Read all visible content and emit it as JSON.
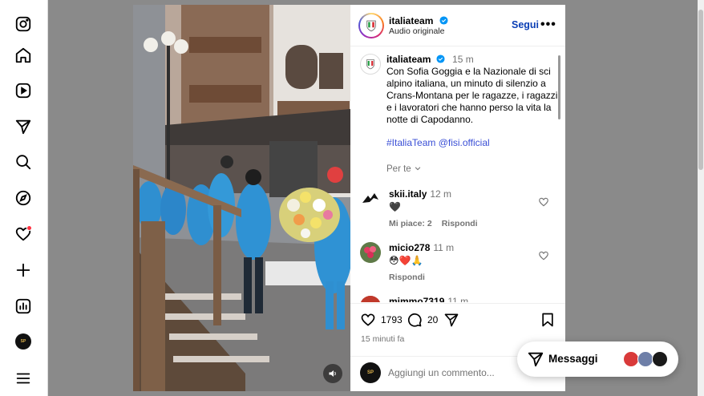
{
  "nav": {
    "items": [
      {
        "name": "instagram-icon"
      },
      {
        "name": "home-icon"
      },
      {
        "name": "reels-icon"
      },
      {
        "name": "direct-icon"
      },
      {
        "name": "search-icon"
      },
      {
        "name": "explore-icon"
      },
      {
        "name": "notifications-icon"
      },
      {
        "name": "create-icon"
      },
      {
        "name": "dashboard-icon"
      },
      {
        "name": "profile-avatar"
      },
      {
        "name": "menu-icon"
      }
    ],
    "profile_avatar_text": "sport\nSgRgKg"
  },
  "post": {
    "username": "italiateam",
    "audio": "Audio originale",
    "follow_label": "Segui",
    "more_label": "•••",
    "caption_time": "15 m",
    "caption": "Con Sofia Goggia e la Nazionale di sci alpino italiana, un minuto di silenzio a Crans-Montana per le ragazze, i ragazzi e i lavoratori che hanno perso la vita la notte di Capodanno.",
    "hashtags": "#ItaliaTeam @fisi.official",
    "per_te": "Per te",
    "likes": "1793",
    "comments_count": "20",
    "posted_ago": "15 minuti fa",
    "comment_placeholder": "Aggiungi un commento..."
  },
  "comments": [
    {
      "user": "skii.italy",
      "time": "12 m",
      "text": "🖤",
      "likes": "Mi piace: 2",
      "reply": "Rispondi"
    },
    {
      "user": "micio278",
      "time": "11 m",
      "text": "😳❤️🙏",
      "likes": "",
      "reply": "Rispondi"
    },
    {
      "user": "mimmo7319",
      "time": "11 m",
      "text": "",
      "likes": "",
      "reply": ""
    }
  ],
  "messages": {
    "label": "Messaggi"
  },
  "colors": {
    "link": "#3a4fd6",
    "follow": "#0b3fb5",
    "notification": "#ff3040",
    "jacket": "#2f8fd0"
  }
}
